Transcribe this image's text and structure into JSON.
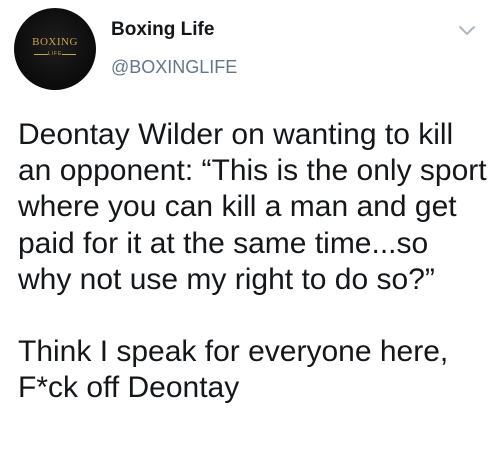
{
  "author": {
    "display_name": "Boxing Life",
    "handle": "@BOXINGLIFE",
    "avatar": {
      "logo_text": "BOXING",
      "logo_subtext": "LIFE",
      "logo_color": "#c9a24a",
      "background_color": "#0b0b0b"
    }
  },
  "menu": {
    "icon": "chevron-down-icon"
  },
  "tweet": {
    "paragraph_1": "Deontay Wilder on wanting to kill an opponent: “This is the only sport where you can kill a man and get paid for it at the same time...so why not use my right to do so?”",
    "paragraph_2": "Think I speak for everyone here, F*ck off Deontay"
  },
  "colors": {
    "text_primary": "#14171a",
    "text_secondary": "#657786",
    "caret": "#aab8c2"
  }
}
